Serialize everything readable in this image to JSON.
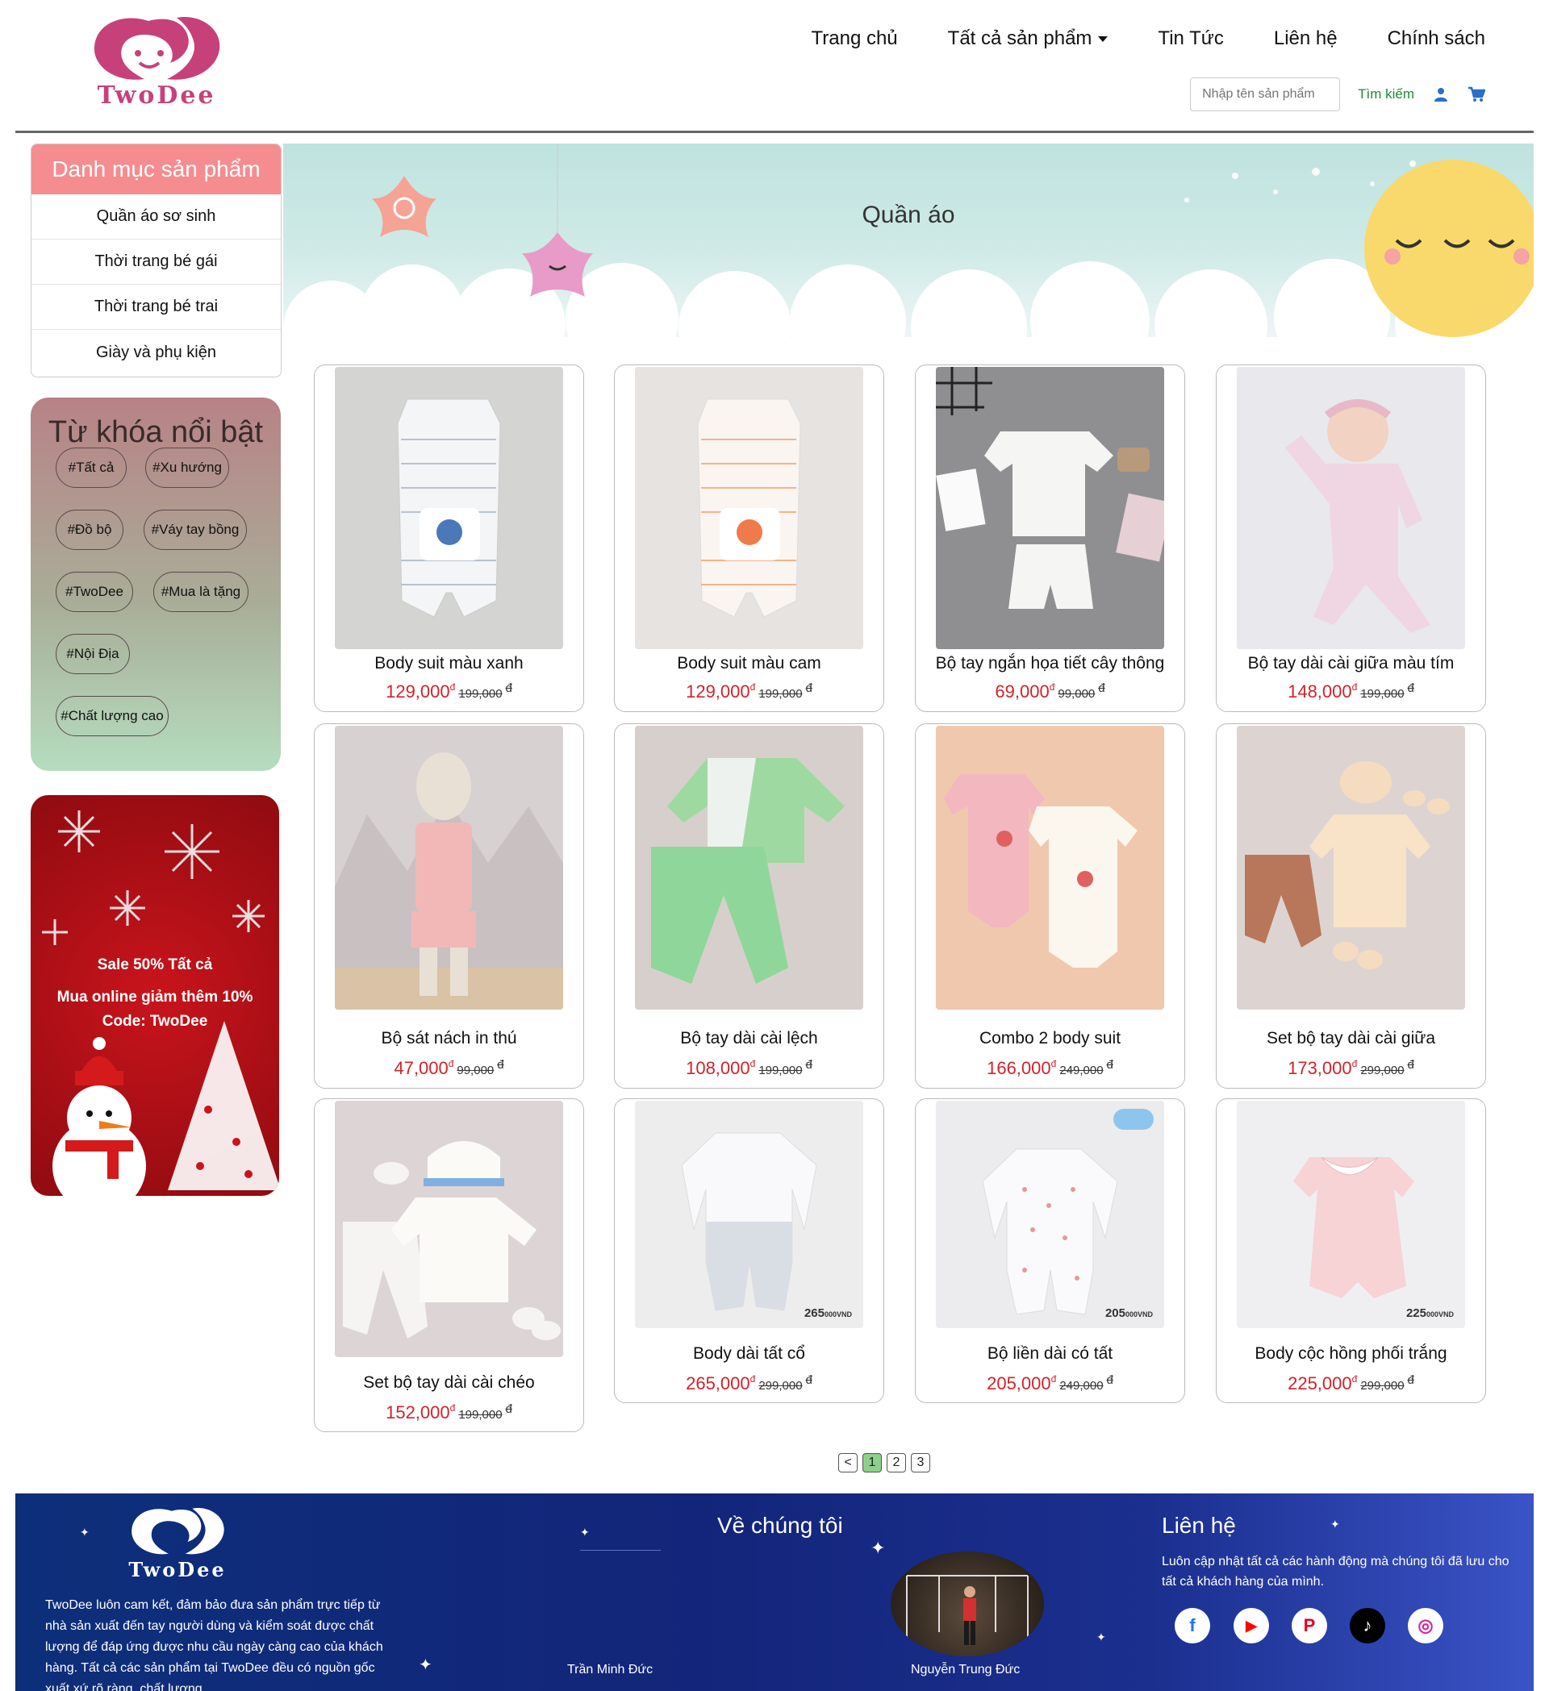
{
  "brand": {
    "name": "TwoDee",
    "accent": "#c6417a"
  },
  "nav": {
    "items": [
      "Trang chủ",
      "Tất cả sản phẩm",
      "Tin Tức",
      "Liên hệ",
      "Chính sách"
    ],
    "search_placeholder": "Nhập tên sản phẩm",
    "search_label": "Tìm kiếm",
    "user_icon": "user-icon",
    "cart_icon": "cart-icon"
  },
  "categories": {
    "title": "Danh mục sản phẩm",
    "items": [
      "Quần áo sơ sinh",
      "Thời trang bé gái",
      "Thời trang bé trai",
      "Giày và phụ kiện"
    ]
  },
  "keywords": {
    "title": "Từ khóa nổi bật",
    "tags": [
      "#Tất cả",
      "#Xu hướng",
      "#Đồ bộ",
      "#Váy tay bồng",
      "#TwoDee",
      "#Mua là tặng",
      "#Nội Địa",
      "#Chất lượng cao"
    ]
  },
  "promo": {
    "line1": "Sale 50% Tất cả",
    "line2": "Mua online giảm thêm 10%",
    "line3": "Code: TwoDee"
  },
  "banner": {
    "title": "Quần áo"
  },
  "currency_symbol": "đ",
  "products": [
    {
      "name": "Body suit màu xanh",
      "price": "129,000",
      "old_price": "199,000"
    },
    {
      "name": "Body suit màu cam",
      "price": "129,000",
      "old_price": "199,000"
    },
    {
      "name": "Bộ tay ngắn họa tiết cây thông",
      "price": "69,000",
      "old_price": "99,000"
    },
    {
      "name": "Bộ tay dài cài giữa màu tím",
      "price": "148,000",
      "old_price": "199,000"
    },
    {
      "name": "Bộ sát nách in thú",
      "price": "47,000",
      "old_price": "99,000"
    },
    {
      "name": "Bộ tay dài cài lệch",
      "price": "108,000",
      "old_price": "199,000"
    },
    {
      "name": "Combo 2 body suit",
      "price": "166,000",
      "old_price": "249,000"
    },
    {
      "name": "Set bộ tay dài cài giữa",
      "price": "173,000",
      "old_price": "299,000"
    },
    {
      "name": "Set bộ tay dài cài chéo",
      "price": "152,000",
      "old_price": "199,000"
    },
    {
      "name": "Body dài tất cổ",
      "price": "265,000",
      "old_price": "299,000",
      "img_label": "265",
      "img_unit": "000VND"
    },
    {
      "name": "Bộ liền dài có tất",
      "price": "205,000",
      "old_price": "249,000",
      "img_label": "205",
      "img_unit": "000VND"
    },
    {
      "name": "Body cộc hồng phối trắng",
      "price": "225,000",
      "old_price": "299,000",
      "img_label": "225",
      "img_unit": "000VND"
    }
  ],
  "pagination": {
    "prev": "<",
    "pages": [
      "1",
      "2",
      "3"
    ],
    "current": "1"
  },
  "footer": {
    "brand": "TwoDee",
    "about": "TwoDee luôn cam kết, đảm bảo đưa sản phẩm trực tiếp từ nhà sản xuất đến tay người dùng và kiểm soát được chất lượng để đáp ứng được nhu cầu ngày càng cao của khách hàng. Tất cả các sản phẩm tại TwoDee đều có nguồn gốc xuất xứ rõ ràng, chất lượng.",
    "about_title": "Về chúng tôi",
    "members": [
      "Trần Minh Đức",
      "Nguyễn Trung Đức"
    ],
    "contact_title": "Liên hệ",
    "contact_text": "Luôn cập nhật tất cả các hành động mà chúng tôi đã lưu cho tất cả khách hàng của mình.",
    "socials": [
      {
        "icon": "facebook-icon",
        "glyph": "f",
        "color": "#ffffff",
        "fg": "#1877f2"
      },
      {
        "icon": "youtube-icon",
        "glyph": "▶",
        "color": "#ffffff",
        "fg": "#ff0000"
      },
      {
        "icon": "pinterest-icon",
        "glyph": "P",
        "color": "#ffffff",
        "fg": "#e60023"
      },
      {
        "icon": "tiktok-icon",
        "glyph": "♪",
        "color": "#000000",
        "fg": "#ffffff"
      },
      {
        "icon": "instagram-icon",
        "glyph": "◎",
        "color": "#ffffff",
        "fg": "#d6249f"
      }
    ]
  }
}
